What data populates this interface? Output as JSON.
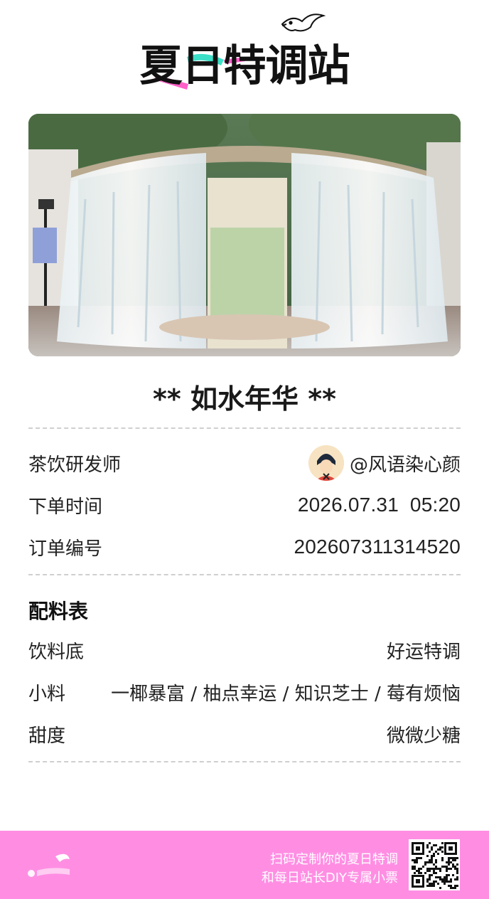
{
  "brand": {
    "logo_text": "夏日特调站"
  },
  "photo": {
    "alt": "fountain photo",
    "icon": "fountain-image"
  },
  "drink": {
    "title": "** 如水年华 **"
  },
  "order_info": {
    "developer_label": "茶饮研发师",
    "developer_value": "@风语染心颜",
    "time_label": "下单时间",
    "time_value": "2026.07.31  05:20",
    "number_label": "订单编号",
    "number_value": "202607311314520"
  },
  "ingredients": {
    "heading": "配料表",
    "base_label": "饮料底",
    "base_value": "好运特调",
    "toppings_label": "小料",
    "toppings_value": "一椰暴富 / 柚点幸运 / 知识芝士 / 莓有烦恼",
    "sweetness_label": "甜度",
    "sweetness_value": "微微少糖"
  },
  "footer": {
    "line1": "扫码定制你的夏日特调",
    "line2": "和每日站长DIY专属小票",
    "background": "#ff8ee3"
  }
}
